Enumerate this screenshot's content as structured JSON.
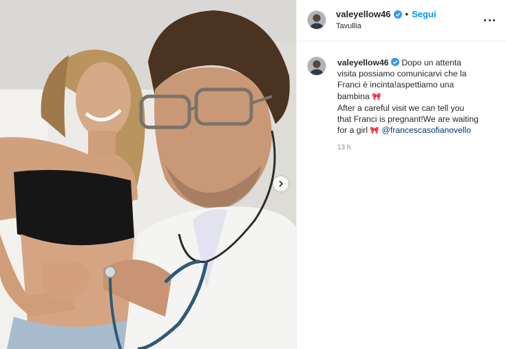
{
  "post": {
    "next_icon": "chevron-right-icon"
  },
  "header": {
    "username": "valeyellow46",
    "separator": "•",
    "follow_label": "Segui",
    "location": "Tavullia",
    "verified_icon": "verified-badge-icon",
    "more_icon": "more-options-icon"
  },
  "caption": {
    "username": "valeyellow46",
    "text_it_1": "Dopo un attenta",
    "text_it_2": "visita possiamo comunicarvi che la",
    "text_it_3": "Franci è incinta!aspettiamo una",
    "text_it_4": "bambina",
    "text_en_1": "After a careful visit we can tell you",
    "text_en_2": "that Franci is pregnant!We are waiting",
    "text_en_3": "for a girl",
    "emoji_bow": "🎀",
    "mention": "@francescasofianovello",
    "timestamp": "13 h"
  },
  "colors": {
    "follow": "#0095f6",
    "mention": "#00376b",
    "muted": "#8e8e8e"
  }
}
